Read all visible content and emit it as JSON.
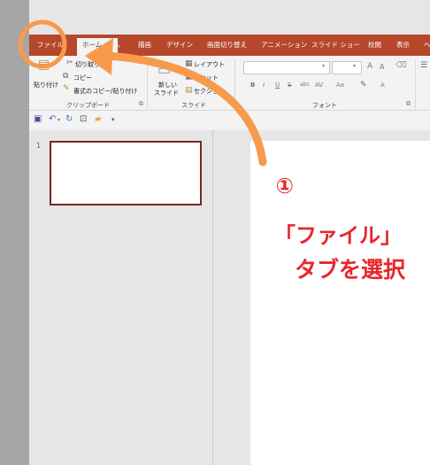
{
  "ribbon": {
    "tabs": [
      "ファイル",
      "ホーム",
      "挿入",
      "描画",
      "デザイン",
      "画面切り替え",
      "アニメーション",
      "スライド ショー",
      "校閲",
      "表示",
      "ヘ"
    ],
    "clipboard": {
      "paste": "貼り付け",
      "cut": "切り取り",
      "copy": "コピー",
      "format_painter": "書式のコピー/貼り付け",
      "group": "クリップボード"
    },
    "slides": {
      "new_slide_1": "新しい",
      "new_slide_2": "スライド",
      "layout": "レイアウト",
      "reset": "リセット",
      "section": "セクション",
      "group": "スライド"
    },
    "font": {
      "buttons": [
        "B",
        "I",
        "U",
        "S",
        "abc",
        "AV",
        "Aa",
        "A"
      ],
      "grow": "A",
      "shrink": "A",
      "group": "フォント"
    }
  },
  "thumbnails": {
    "slide_number": "1"
  },
  "annotation": {
    "step": "①",
    "line1": "「ファイル」",
    "line2": "タブを選択",
    "color": "#e8262b",
    "arrow_color": "#f79a4c"
  }
}
